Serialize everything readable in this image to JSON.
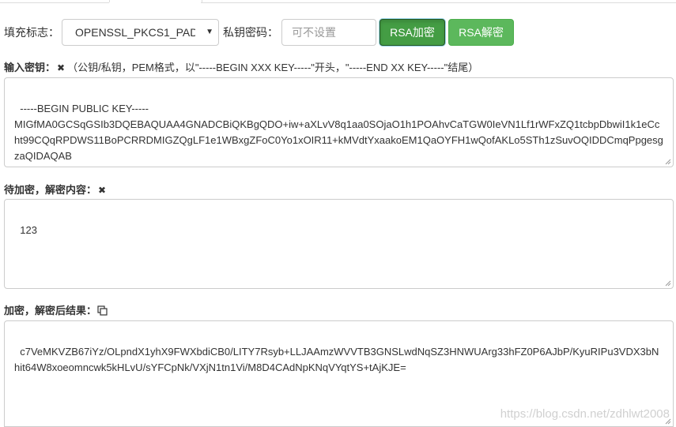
{
  "toolbar": {
    "padding_label": "填充标志：",
    "padding_selected": "OPENSSL_PKCS1_PADDING",
    "password_label": "私钥密码：",
    "password_placeholder": "可不设置",
    "encrypt_label": "RSA加密",
    "decrypt_label": "RSA解密"
  },
  "key_section": {
    "label": "输入密钥：",
    "clear_icon": "✖",
    "hint": "（公钥/私钥，PEM格式，以\"-----BEGIN XXX KEY-----\"开头，\"-----END XX KEY-----\"结尾）",
    "value": "-----BEGIN PUBLIC KEY-----\nMIGfMA0GCSqGSIb3DQEBAQUAA4GNADCBiQKBgQDO+iw+aXLvV8q1aa0SOjaO1h1POAhvCaTGW0IeVN1Lf1rWFxZQ1tcbpDbwiI1k1eCcht99CQqRPDWS11BoPCRRDMIGZQgLF1e1WBxgZFoC0Yo1xOIR11+kMVdtYxaakoEM1QaOYFH1wQofAKLo5STh1zSuvOQIDDCmqPpgesgzaQIDAQAB\n-----END PUBLIC KEY-----"
  },
  "content_section": {
    "label": "待加密，解密内容：",
    "clear_icon": "✖",
    "value": "123"
  },
  "result_section": {
    "label": "加密，解密后结果：",
    "copy_icon": "copy-icon",
    "value": "c7VeMKVZB67iYz/OLpndX1yhX9FWXbdiCB0/LITY7Rsyb+LLJAAmzWVVTB3GNSLwdNqSZ3HNWUArg33hFZ0P6AJbP/KyuRIPu3VDX3bNhit64W8xoeomncwk5kHLvU/sYFCpNk/VXjN1tn1Vi/M8D4CAdNpKNqVYqtYS+tAjKJE="
  },
  "watermark": "https://blog.csdn.net/zdhlwt2008",
  "colors": {
    "encrypt_button": "#449d44",
    "decrypt_button": "#5cb85c",
    "border": "#cccccc"
  }
}
